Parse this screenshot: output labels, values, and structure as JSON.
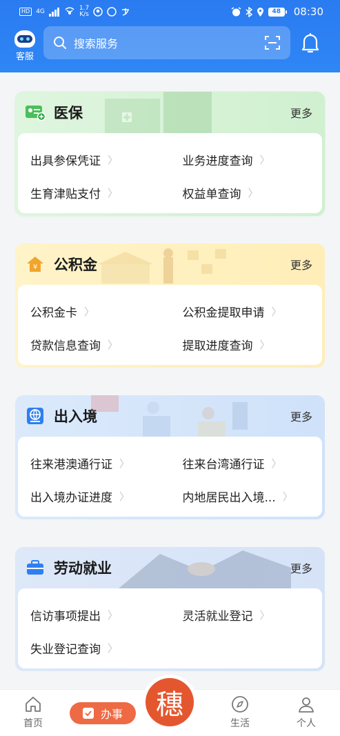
{
  "status_bar": {
    "hd": "HD",
    "net": "4G",
    "speed_value": "1.7",
    "speed_unit": "K/s",
    "battery": "48",
    "time": "08:30"
  },
  "header": {
    "kefu_label": "客服",
    "search_placeholder": "搜索服务",
    "accent": "#2a7bf0"
  },
  "cards": [
    {
      "title": "医保",
      "more": "更多",
      "items": [
        "出具参保凭证",
        "业务进度查询",
        "生育津贴支付",
        "权益单查询"
      ]
    },
    {
      "title": "公积金",
      "more": "更多",
      "items": [
        "公积金卡",
        "公积金提取申请",
        "贷款信息查询",
        "提取进度查询"
      ]
    },
    {
      "title": "出入境",
      "more": "更多",
      "items": [
        "往来港澳通行证",
        "往来台湾通行证",
        "出入境办证进度",
        "内地居民出入境..."
      ]
    },
    {
      "title": "劳动就业",
      "more": "更多",
      "items": [
        "信访事项提出",
        "灵活就业登记",
        "失业登记查询"
      ]
    }
  ],
  "bottom_nav": {
    "home": "首页",
    "banshi": "办事",
    "center_glyph": "穗",
    "life": "生活",
    "profile": "个人",
    "banshi_color": "#ee6a44"
  }
}
